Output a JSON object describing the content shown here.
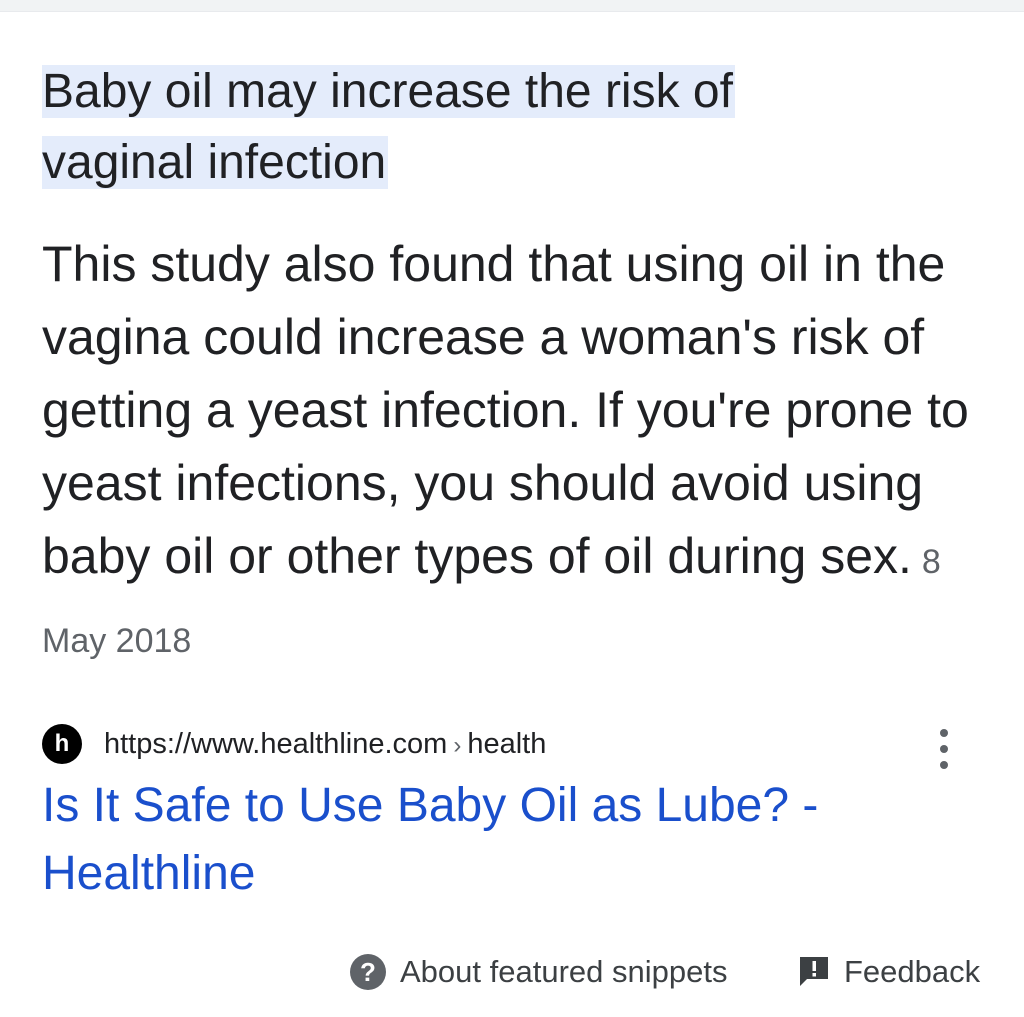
{
  "snippet": {
    "heading_line1": "Baby oil may increase the risk of",
    "heading_line2": "vaginal infection",
    "body": "This study also found that using oil in the vagina could increase a woman's risk of getting a yeast infection. If you're prone to yeast infections, you should avoid using baby oil or other types of oil during sex.",
    "date": "8 May 2018"
  },
  "source": {
    "favicon_letter": "h",
    "url": "https://www.healthline.com",
    "separator": "›",
    "path": "health",
    "icon": "more-vert-icon"
  },
  "result": {
    "title": "Is It Safe to Use Baby Oil as Lube? - Healthline",
    "link_color": "#1a4fcc"
  },
  "footer": {
    "about_label": "About featured snippets",
    "about_icon": "help-icon",
    "feedback_label": "Feedback",
    "feedback_icon": "feedback-icon"
  },
  "colors": {
    "highlight": "#e4ecfb",
    "text": "#202124",
    "muted": "#5f6368"
  }
}
